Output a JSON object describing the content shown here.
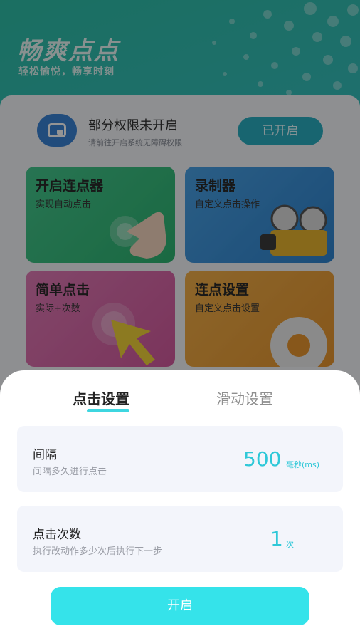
{
  "app": {
    "title": "畅爽点点",
    "subtitle": "轻松愉悦，畅享时刻"
  },
  "permission": {
    "title": "部分权限未开启",
    "subtitle": "请前往开启系统无障碍权限",
    "button_label": "已开启"
  },
  "features": [
    {
      "title": "开启连点器",
      "subtitle": "实现自动点击",
      "icon": "pointing-hand-icon"
    },
    {
      "title": "录制器",
      "subtitle": "自定义点击操作",
      "icon": "film-camera-icon"
    },
    {
      "title": "简单点击",
      "subtitle": "实际+次数",
      "icon": "cursor-arrow-icon"
    },
    {
      "title": "连点设置",
      "subtitle": "自定义点击设置",
      "icon": "gear-icon"
    }
  ],
  "sheet": {
    "tabs": [
      {
        "label": "点击设置",
        "active": true
      },
      {
        "label": "滑动设置",
        "active": false
      }
    ],
    "settings": [
      {
        "label": "间隔",
        "description": "间隔多久进行点击",
        "value": "500",
        "unit": "毫秒(ms)"
      },
      {
        "label": "点击次数",
        "description": "执行改动作多少次后执行下一步",
        "value": "1",
        "unit": "次"
      }
    ],
    "start_button_label": "开启"
  },
  "colors": {
    "accent": "#35e3ea",
    "value_text": "#2fc8d8",
    "header_gradient_start": "#2fc0a8",
    "header_gradient_end": "#5fa7e6"
  }
}
